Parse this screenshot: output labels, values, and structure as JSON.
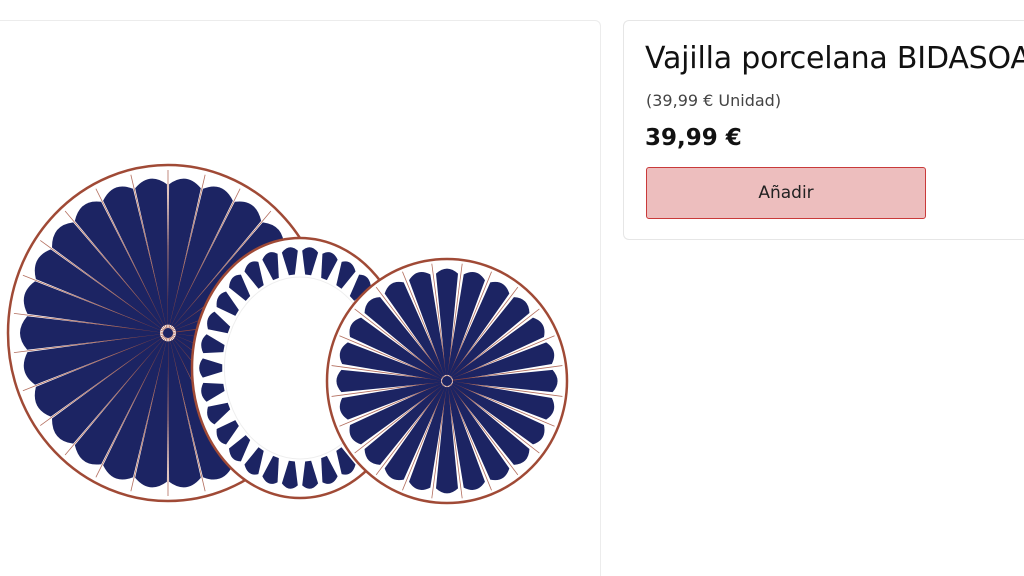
{
  "product": {
    "title": "Vajilla porcelana BIDASOA",
    "unit_price": "(39,99 € Unidad)",
    "price": "39,99 €",
    "add_label": "Añadir"
  },
  "image": {
    "subject": "three-plates",
    "stripe_color": "#1c2463",
    "rim_color": "#a04a36"
  },
  "colors": {
    "button_bg": "#edbebe",
    "button_border": "#c93a3a"
  }
}
